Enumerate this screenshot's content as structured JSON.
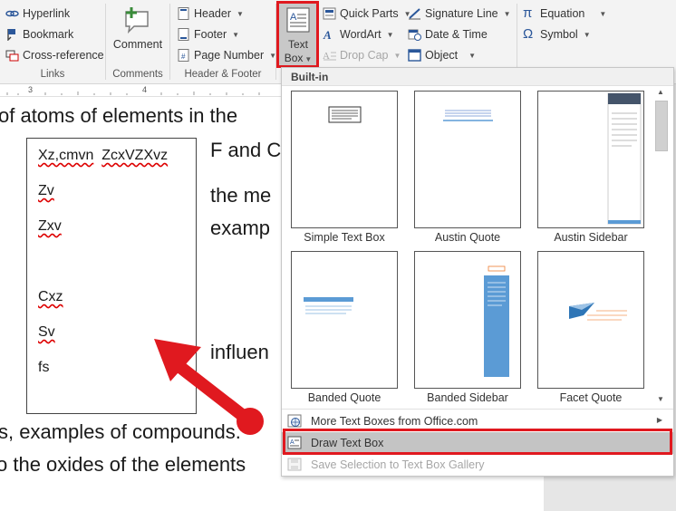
{
  "ribbon": {
    "links": {
      "hyperlink": "Hyperlink",
      "bookmark": "Bookmark",
      "cross_reference": "Cross-reference",
      "group": "Links"
    },
    "comments": {
      "comment": "Comment",
      "group": "Comments"
    },
    "header_footer": {
      "header": "Header",
      "footer": "Footer",
      "page_number": "Page Number",
      "group": "Header & Footer"
    },
    "text": {
      "text_box_line1": "Text",
      "text_box_line2": "Box",
      "quick_parts": "Quick Parts",
      "wordart": "WordArt",
      "drop_cap": "Drop Cap",
      "signature_line": "Signature Line",
      "date_time": "Date & Time",
      "object": "Object"
    },
    "symbols": {
      "equation": "Equation",
      "symbol": "Symbol"
    }
  },
  "ruler": {
    "marks": [
      "3",
      "4"
    ]
  },
  "document": {
    "lines": {
      "l1": "of atoms of elements in the",
      "l2": "F and C",
      "l3": "the me",
      "l4": "examp",
      "l5": "influen",
      "l6": "s, examples of compounds.",
      "l7": "o the oxides of the elements"
    },
    "textbox_lines": [
      "Xz,cmvn",
      "ZcxVZXvz",
      "Zv",
      "Zxv",
      "Cxz",
      "Sv",
      "fs"
    ]
  },
  "gallery": {
    "section": "Built-in",
    "thumbnails": [
      {
        "label": "Simple Text Box"
      },
      {
        "label": "Austin Quote"
      },
      {
        "label": "Austin Sidebar"
      },
      {
        "label": "Banded Quote"
      },
      {
        "label": "Banded Sidebar"
      },
      {
        "label": "Facet Quote"
      }
    ],
    "menu": {
      "more": "More Text Boxes from Office.com",
      "draw": "Draw Text Box",
      "save": "Save Selection to Text Box Gallery"
    }
  },
  "colors": {
    "highlight_red": "#e0191f",
    "accent_blue": "#2b579a",
    "banded_blue": "#5b9bd5",
    "facet_orange": "#ed7d31"
  }
}
